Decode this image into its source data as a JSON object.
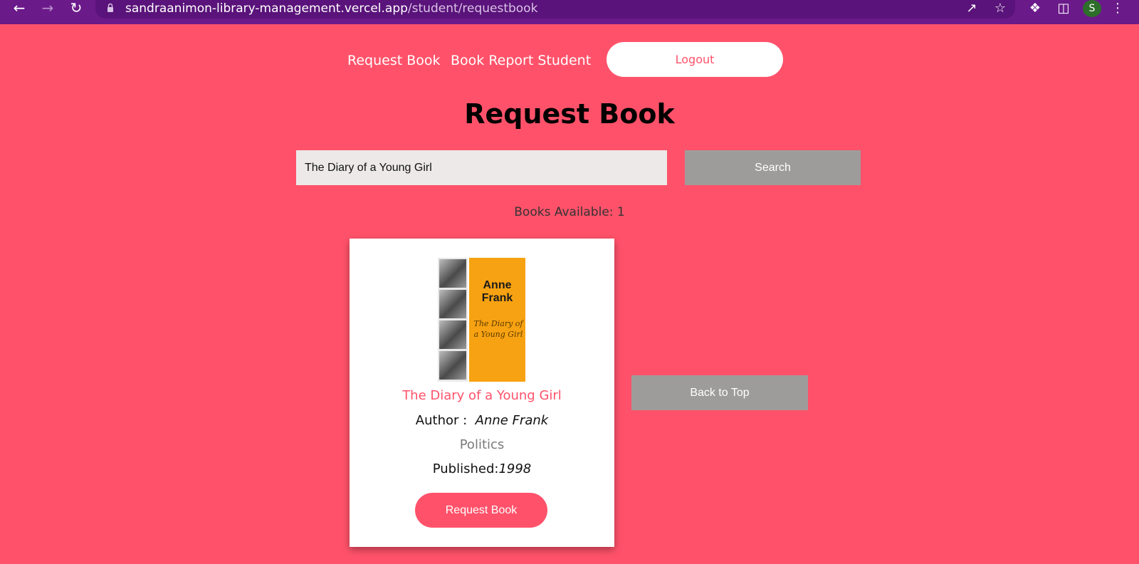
{
  "browser": {
    "url_host": "sandraanimon-library-management.vercel.app",
    "url_path": "/student/requestbook",
    "profile_initial": "S"
  },
  "nav": {
    "request_book": "Request Book",
    "book_report": "Book Report Student",
    "logout": "Logout"
  },
  "page": {
    "title": "Request Book"
  },
  "search": {
    "value": "The Diary of a Young Girl",
    "button": "Search"
  },
  "results": {
    "available_text": "Books Available: 1"
  },
  "book": {
    "cover_author_line1": "Anne",
    "cover_author_line2": "Frank",
    "cover_title_script": "The Diary of a Young Girl",
    "title": "The Diary of a Young Girl",
    "author_label": "Author :",
    "author": "Anne Frank",
    "genre": "Politics",
    "published_label": "Published:",
    "published_year": "1998",
    "request_button": "Request Book"
  },
  "back_to_top": "Back to Top",
  "colors": {
    "background": "#ff526a",
    "browser_bar": "#6b1a8a",
    "button_gray": "#9e9c9b",
    "input_bg": "#ede9e9"
  }
}
